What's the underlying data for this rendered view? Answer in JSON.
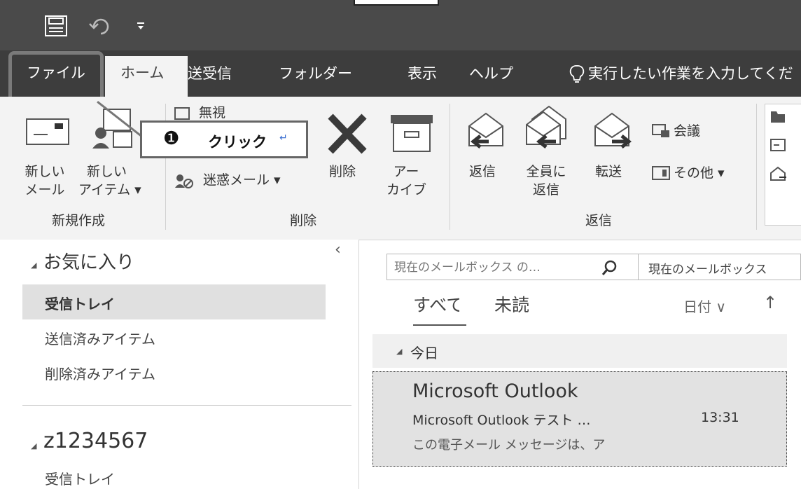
{
  "qat": {
    "save_icon": "save-icon",
    "undo_icon": "undo-icon",
    "customize_icon": "dropdown-arrow-icon"
  },
  "tabs": {
    "file": "ファイル",
    "home": "ホーム",
    "send_receive": "送受信",
    "folder": "フォルダー",
    "view": "表示",
    "help": "ヘルプ",
    "tell_me": "実行したい作業を入力してくだ"
  },
  "callout": {
    "marker": "❶",
    "text": "クリック",
    "return_mark": "↵"
  },
  "ribbon": {
    "new_email": [
      "新しい",
      "メール"
    ],
    "new_items": [
      "新しい",
      "アイテム ▾"
    ],
    "ignore": "無視",
    "junk": "迷惑メール ▾",
    "delete": "削除",
    "archive": [
      "アー",
      "カイブ"
    ],
    "reply": "返信",
    "reply_all": [
      "全員に",
      "返信"
    ],
    "forward": "転送",
    "meeting": "会議",
    "more": "その他 ▾",
    "groups": {
      "new": "新規作成",
      "delete": "削除",
      "respond": "返信"
    }
  },
  "nav": {
    "favorites": "お気に入り",
    "collapse_arrow": "‹",
    "inbox": "受信トレイ",
    "sent": "送信済みアイテム",
    "deleted": "削除済みアイテム",
    "account": "z1234567",
    "account_inbox": "受信トレイ"
  },
  "list": {
    "search_placeholder": "現在のメールボックス の…",
    "scope": "現在のメールボックス",
    "filter_all": "すべて",
    "filter_unread": "未読",
    "sort": "日付 ∨",
    "sort_dir": "↑",
    "group_today": "今日",
    "message": {
      "sender": "Microsoft Outlook",
      "subject": "Microsoft Outlook テスト …",
      "time": "13:31",
      "preview": "この電子メール メッセージは、ア"
    }
  },
  "colors": {
    "title_bar": "#4a4a4a",
    "tab_bar": "#3d3d3d",
    "ribbon": "#f3f3f3",
    "selected": "#e2e2e2"
  }
}
